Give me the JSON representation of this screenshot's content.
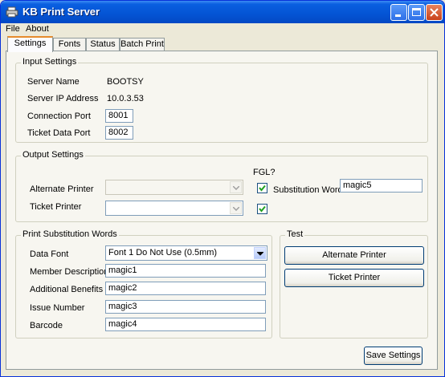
{
  "window": {
    "title": "KB Print Server"
  },
  "menu": {
    "file": "File",
    "about": "About"
  },
  "tabs": {
    "settings": "Settings",
    "fonts": "Fonts",
    "status": "Status",
    "batch": "Batch Print"
  },
  "input_settings": {
    "legend": "Input Settings",
    "server_name_label": "Server Name",
    "server_name_value": "BOOTSY",
    "server_ip_label": "Server IP Address",
    "server_ip_value": "10.0.3.53",
    "connection_port_label": "Connection Port",
    "connection_port_value": "8001",
    "ticket_data_port_label": "Ticket Data Port",
    "ticket_data_port_value": "8002"
  },
  "output_settings": {
    "legend": "Output Settings",
    "fgl_header": "FGL?",
    "alternate_printer_label": "Alternate Printer",
    "alternate_printer_value": "",
    "alternate_printer_fgl": true,
    "ticket_printer_label": "Ticket Printer",
    "ticket_printer_value": "",
    "ticket_printer_fgl": true,
    "substitution_word_label": "Substitution Word",
    "substitution_word_value": "magic5"
  },
  "print_substitution": {
    "legend": "Print Substitution Words",
    "data_font_label": "Data Font",
    "data_font_value": "Font 1 Do Not Use (0.5mm)",
    "member_description_label": "Member Description",
    "member_description_value": "magic1",
    "additional_benefits_label": "Additional Benefits",
    "additional_benefits_value": "magic2",
    "issue_number_label": "Issue Number",
    "issue_number_value": "magic3",
    "barcode_label": "Barcode",
    "barcode_value": "magic4"
  },
  "test": {
    "legend": "Test",
    "alternate_printer_button": "Alternate Printer",
    "ticket_printer_button": "Ticket Printer"
  },
  "save_settings_button": "Save Settings",
  "icons": {
    "app": "printer-icon",
    "minimize": "minimize-icon",
    "maximize": "maximize-icon",
    "close": "close-icon",
    "dropdown": "chevron-down-icon",
    "check": "checkmark-icon"
  },
  "colors": {
    "titlebar": "#0454d4",
    "window_bg": "#ece9d8",
    "tab_accent": "#e68b2c",
    "close_button": "#c9421c"
  }
}
